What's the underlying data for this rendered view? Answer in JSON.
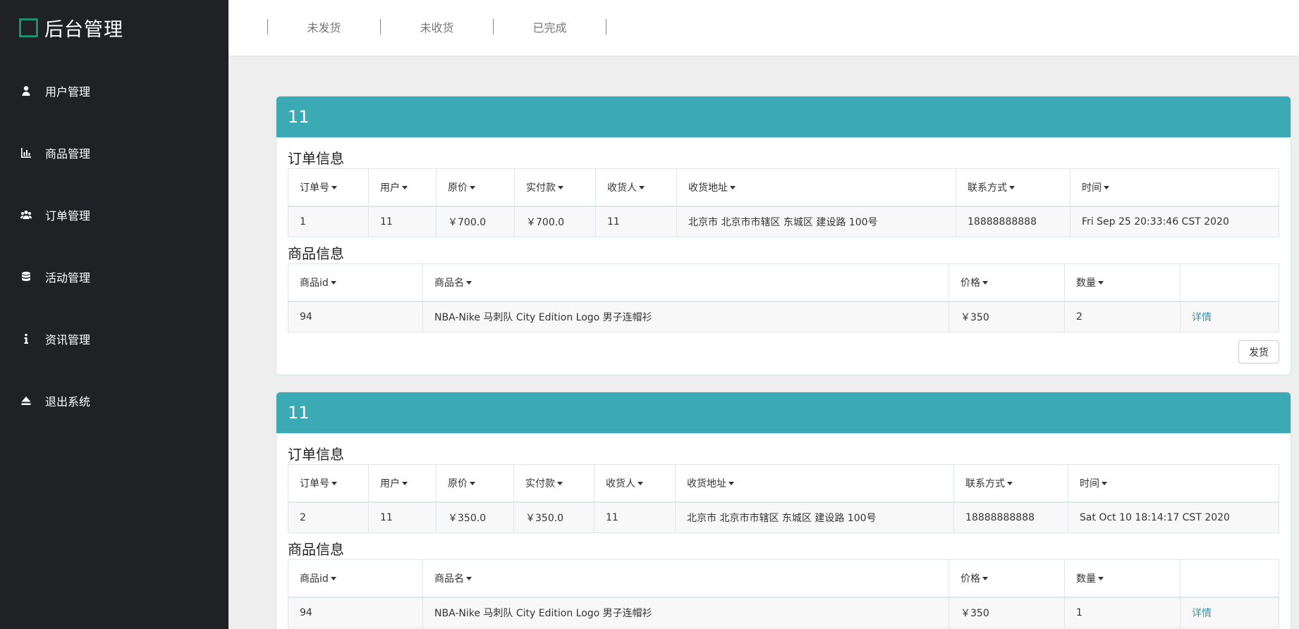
{
  "app": {
    "title": "后台管理"
  },
  "sidebar": {
    "items": [
      {
        "label": "用户管理",
        "icon": "user-icon"
      },
      {
        "label": "商品管理",
        "icon": "bar-chart-icon"
      },
      {
        "label": "订单管理",
        "icon": "users-icon"
      },
      {
        "label": "活动管理",
        "icon": "database-icon"
      },
      {
        "label": "资讯管理",
        "icon": "info-icon"
      },
      {
        "label": "退出系统",
        "icon": "eject-icon"
      }
    ]
  },
  "tabs": [
    "未发货",
    "未收货",
    "已完成"
  ],
  "order_headers": [
    "订单号",
    "用户",
    "原价",
    "实付款",
    "收货人",
    "收货地址",
    "联系方式",
    "时间"
  ],
  "product_headers": [
    "商品id",
    "商品名",
    "价格",
    "数量"
  ],
  "labels": {
    "order_info": "订单信息",
    "product_info": "商品信息",
    "detail": "详情",
    "ship": "发货"
  },
  "orders": [
    {
      "title": "11",
      "row": [
        "1",
        "11",
        "￥700.0",
        "￥700.0",
        "11",
        "北京市 北京市市辖区 东城区 建设路 100号",
        "18888888888",
        "Fri Sep 25 20:33:46 CST 2020"
      ],
      "product": [
        "94",
        "NBA-Nike 马刺队 City Edition Logo 男子连帽衫",
        "￥350",
        "2"
      ]
    },
    {
      "title": "11",
      "row": [
        "2",
        "11",
        "￥350.0",
        "￥350.0",
        "11",
        "北京市 北京市市辖区 东城区 建设路 100号",
        "18888888888",
        "Sat Oct 10 18:14:17 CST 2020"
      ],
      "product": [
        "94",
        "NBA-Nike 马刺队 City Edition Logo 男子连帽衫",
        "￥350",
        "1"
      ]
    }
  ]
}
